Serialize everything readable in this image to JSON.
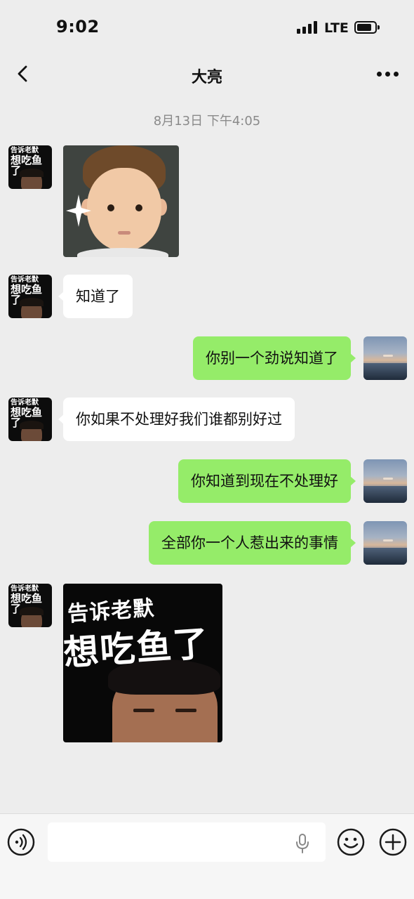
{
  "status_bar": {
    "time": "9:02",
    "network": "LTE"
  },
  "nav": {
    "title": "大亮",
    "back_icon": "chevron-left-icon",
    "more_icon": "more-horizontal-icon"
  },
  "chat": {
    "timestamp": "8月13日 下午4:05",
    "friend_avatar_text": {
      "line1": "告诉老默",
      "line2": "想吃鱼了"
    },
    "messages": [
      {
        "side": "in",
        "type": "sticker",
        "sticker": "baby-face-sticker"
      },
      {
        "side": "in",
        "type": "text",
        "text": "知道了"
      },
      {
        "side": "out",
        "type": "text",
        "text": "你别一个劲说知道了"
      },
      {
        "side": "in",
        "type": "text",
        "text": "你如果不处理好我们谁都别好过"
      },
      {
        "side": "out",
        "type": "text",
        "text": "你知道到现在不处理好"
      },
      {
        "side": "out",
        "type": "text",
        "text": "全部你一个人惹出来的事情"
      },
      {
        "side": "in",
        "type": "sticker",
        "sticker": "poster-sticker",
        "poster_text": {
          "line1": "告诉老默",
          "line2": "想吃鱼了"
        }
      }
    ]
  },
  "input_bar": {
    "input_value": "",
    "input_placeholder": "",
    "icons": [
      "voice-icon",
      "microphone-icon",
      "emoji-icon",
      "plus-icon"
    ]
  },
  "colors": {
    "background": "#ededed",
    "bubble_in": "#ffffff",
    "bubble_out": "#95ec69",
    "timestamp": "#8a8a8a"
  }
}
